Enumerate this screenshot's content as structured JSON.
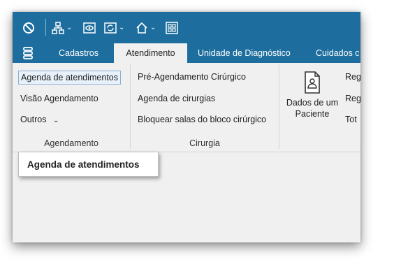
{
  "tabs": [
    {
      "label": "Cadastros"
    },
    {
      "label": "Atendimento"
    },
    {
      "label": "Unidade de Diagnóstico"
    },
    {
      "label": "Cuidados c"
    }
  ],
  "groups": {
    "agendamento": {
      "label": "Agendamento",
      "items": [
        "Agenda de atendimentos",
        "Visão Agendamento",
        "Outros"
      ]
    },
    "cirurgia": {
      "label": "Cirurgia",
      "items": [
        "Pré-Agendamento Cirúrgico",
        "Agenda de cirurgias",
        "Bloquear salas do bloco cirúrgico"
      ]
    },
    "paciente": {
      "button_line1": "Dados de um",
      "button_line2": "Paciente",
      "cut_items": [
        "Reg",
        "Reg",
        "Tot"
      ]
    }
  },
  "tooltip": "Agenda de atendimentos",
  "colors": {
    "titlebar": "#1d6e9e",
    "ribbon": "#f0f0f0"
  },
  "icons": [
    "block-icon",
    "hierarchy-icon",
    "eye-icon",
    "refresh-icon",
    "home-icon",
    "grid-icon",
    "menu-icon",
    "patient-document-icon"
  ]
}
